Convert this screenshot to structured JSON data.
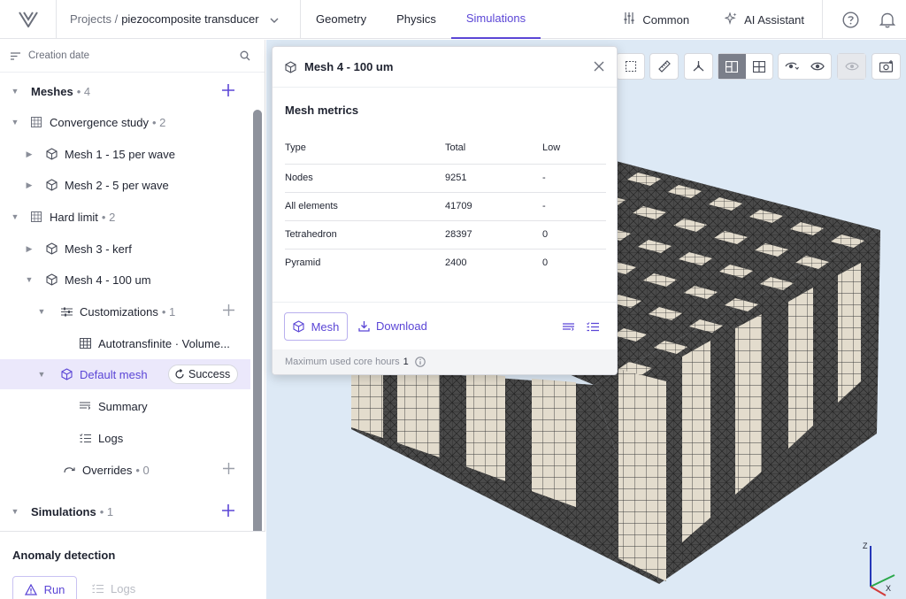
{
  "header": {
    "breadcrumb_prefix": "Projects /",
    "project": "piezocomposite transducer",
    "tabs": [
      {
        "label": "Geometry",
        "active": false
      },
      {
        "label": "Physics",
        "active": false
      },
      {
        "label": "Simulations",
        "active": true
      }
    ],
    "common_label": "Common",
    "assistant_label": "AI Assistant"
  },
  "sidebar": {
    "sort_label": "Creation date",
    "meshes": {
      "label": "Meshes",
      "count": "• 4"
    },
    "convergence": {
      "label": "Convergence study",
      "count": "• 2"
    },
    "mesh1": "Mesh 1 - 15 per wave",
    "mesh2": "Mesh 2 - 5 per wave",
    "hardlimit": {
      "label": "Hard limit",
      "count": "• 2"
    },
    "mesh3": "Mesh 3 - kerf",
    "mesh4": "Mesh 4 - 100 um",
    "customizations": {
      "label": "Customizations",
      "count": "• 1"
    },
    "autotransfinite": "Autotransfinite · Volume...",
    "default_mesh": "Default mesh",
    "status": "Success",
    "summary": "Summary",
    "logs": "Logs",
    "overrides": {
      "label": "Overrides",
      "count": "• 0"
    },
    "simulations": {
      "label": "Simulations",
      "count": "• 1"
    }
  },
  "anomaly": {
    "title": "Anomaly detection",
    "run_label": "Run",
    "logs_label": "Logs"
  },
  "popup": {
    "title": "Mesh 4 - 100 um",
    "section": "Mesh metrics",
    "columns": [
      "Type",
      "Total",
      "Low"
    ],
    "rows": [
      {
        "type": "Nodes",
        "total": "9251",
        "low": "-"
      },
      {
        "type": "All elements",
        "total": "41709",
        "low": "-"
      },
      {
        "type": "Tetrahedron",
        "total": "28397",
        "low": "0"
      },
      {
        "type": "Pyramid",
        "total": "2400",
        "low": "0"
      }
    ],
    "mesh_button": "Mesh",
    "download_button": "Download",
    "core_hours_label": "Maximum used core hours",
    "core_hours_value": "1"
  },
  "axes": {
    "z": "Z",
    "x": "X"
  },
  "colors": {
    "accent": "#5b46d6",
    "viewport_bg": "#dde9f5",
    "mesh_light": "#e3dccd",
    "mesh_dark": "#4a4a4a"
  }
}
